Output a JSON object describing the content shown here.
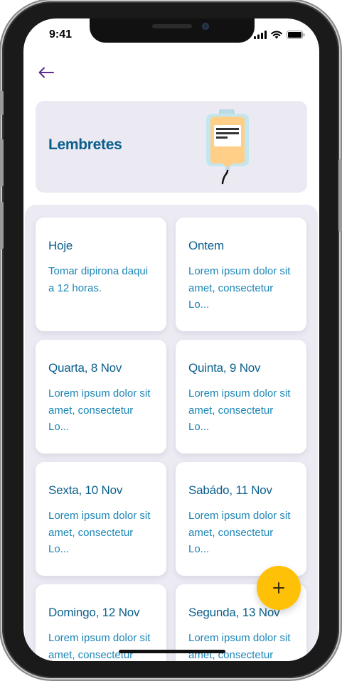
{
  "status_bar": {
    "time": "9:41"
  },
  "header": {
    "title": "Lembretes"
  },
  "reminders": [
    {
      "title": "Hoje",
      "text": "Tomar dipirona daqui a 12 horas."
    },
    {
      "title": "Ontem",
      "text": "Lorem ipsum dolor sit amet, consectetur Lo..."
    },
    {
      "title": "Quarta, 8 Nov",
      "text": "Lorem ipsum dolor sit amet, consectetur Lo..."
    },
    {
      "title": "Quinta, 9 Nov",
      "text": "Lorem ipsum dolor sit amet, consectetur Lo..."
    },
    {
      "title": "Sexta, 10 Nov",
      "text": "Lorem ipsum dolor sit amet, consectetur Lo..."
    },
    {
      "title": "Sabádo, 11 Nov",
      "text": "Lorem ipsum dolor sit amet, consectetur Lo..."
    },
    {
      "title": "Domingo, 12 Nov",
      "text": "Lorem ipsum dolor sit amet, consectetur Lo..."
    },
    {
      "title": "Segunda, 13 Nov",
      "text": "Lorem ipsum dolor sit amet, consectetur Lo..."
    }
  ],
  "fab": {
    "icon": "plus-icon",
    "color": "#ffc107"
  },
  "colors": {
    "title": "#0b5f8c",
    "text": "#1b86b6",
    "back_arrow": "#5b2d91",
    "panel": "#eceaf2"
  }
}
